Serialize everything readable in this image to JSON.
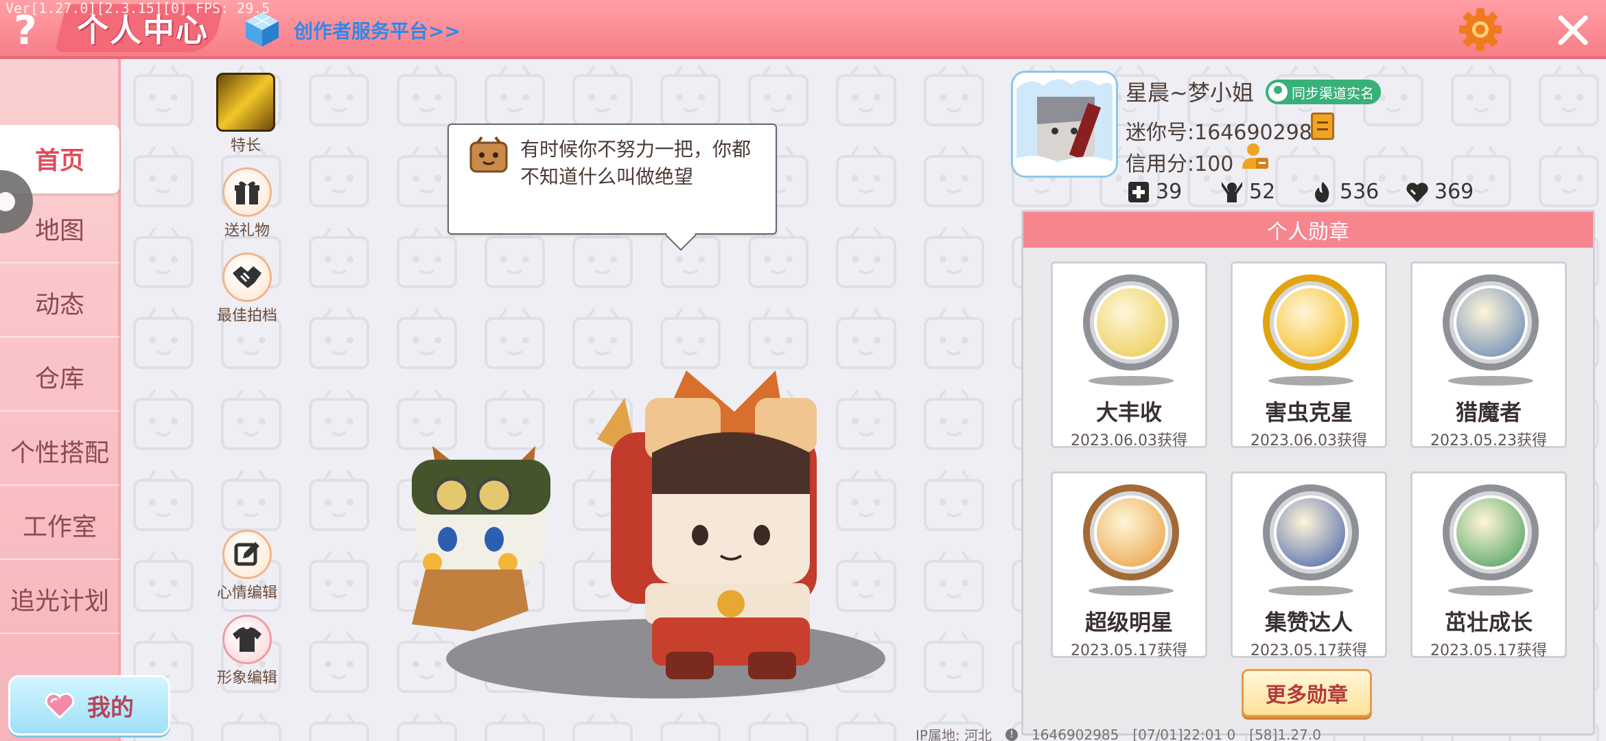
{
  "header": {
    "version_text": "Ver[1.27.0][2.3.15][0] FPS: 29.5",
    "help_glyph": "?",
    "title": "个人中心",
    "creator_link": "创作者服务平台>>"
  },
  "sidebar": {
    "items": [
      {
        "label": "首页"
      },
      {
        "label": "地图"
      },
      {
        "label": "动态"
      },
      {
        "label": "仓库"
      },
      {
        "label": "个性搭配"
      },
      {
        "label": "工作室"
      },
      {
        "label": "追光计划"
      }
    ],
    "my_button": "我的"
  },
  "actions": {
    "talent": "特长",
    "gift": "送礼物",
    "partner": "最佳拍档",
    "mood_edit": "心情编辑",
    "image_edit": "形象编辑"
  },
  "bubble": {
    "text": "有时候你不努力一把，你都不知道什么叫做绝望"
  },
  "profile": {
    "nickname": "星晨~梦小姐",
    "sync_badge": "同步渠道实名",
    "mini_id": "迷你号:1646902985",
    "credit": "信用分:100",
    "stats": [
      {
        "icon": "add-friend-icon",
        "value": "39"
      },
      {
        "icon": "fans-icon",
        "value": "52"
      },
      {
        "icon": "fire-icon",
        "value": "536"
      },
      {
        "icon": "heart-icon",
        "value": "369"
      }
    ]
  },
  "medals": {
    "header": "个人勋章",
    "items": [
      {
        "name": "大丰收",
        "date": "2023.06.03获得",
        "color": "#e9c84a"
      },
      {
        "name": "害虫克星",
        "date": "2023.06.03获得",
        "color": "#f3b512"
      },
      {
        "name": "猎魔者",
        "date": "2023.05.23获得",
        "color": "#5c7fb4"
      },
      {
        "name": "超级明星",
        "date": "2023.05.17获得",
        "color": "#e79b3b"
      },
      {
        "name": "集赞达人",
        "date": "2023.05.17获得",
        "color": "#3f5da8"
      },
      {
        "name": "茁壮成长",
        "date": "2023.05.17获得",
        "color": "#3f9a55"
      }
    ],
    "more_button": "更多勋章"
  },
  "footer": {
    "ip": "IP属地: 河北",
    "uid": "1646902985",
    "time": "[07/01]22:01 0",
    "build": "[58]1.27.0"
  },
  "colors": {
    "topbar": "#f77e88",
    "accent_pink": "#f6858e",
    "link_blue": "#2f88ea",
    "badge_green": "#37b07a"
  }
}
